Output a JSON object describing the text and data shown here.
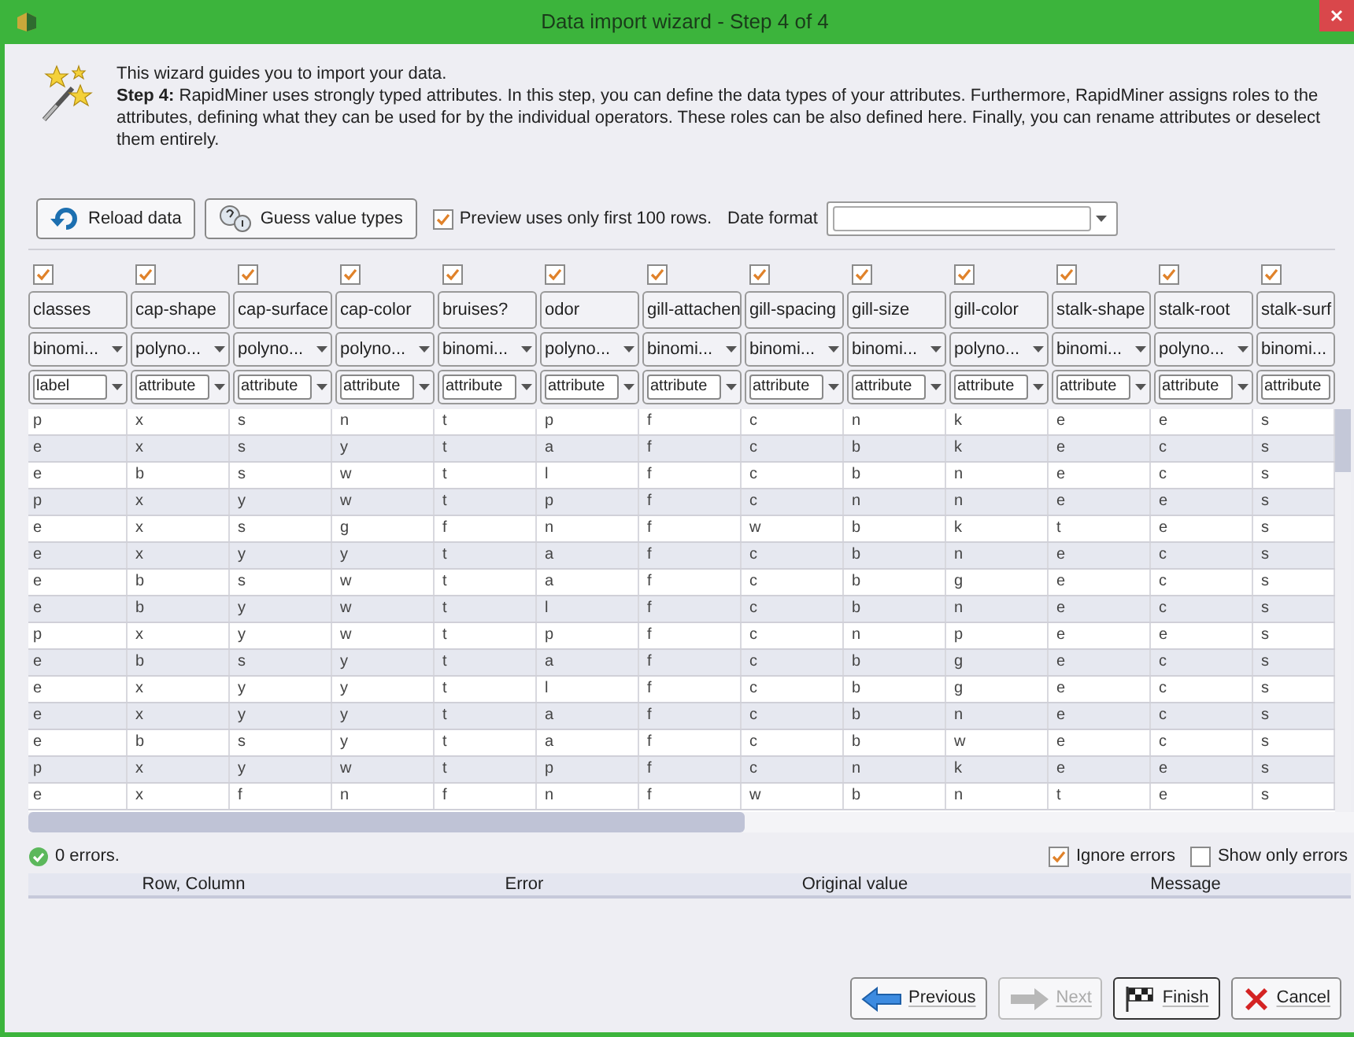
{
  "window": {
    "title": "Data import wizard - Step 4 of 4"
  },
  "intro": {
    "line": "This wizard guides you to import your data.",
    "text": "**Step 4:** RapidMiner uses strongly typed attributes. In this step, you can define the data types of your attributes. Furthermore, RapidMiner assigns roles to the attributes, defining what they can be used for by the individual operators. These roles can be also defined here. Finally, you can rename attributes or deselect them entirely."
  },
  "toolbar": {
    "reload": "Reload data",
    "guess": "Guess value types",
    "preview": {
      "label": "Preview uses only first 100 rows.",
      "checked": true
    },
    "date_format": {
      "label": "Date format"
    }
  },
  "columns": [
    {
      "name": "classes",
      "checked": true,
      "type": "binomi...",
      "role": "label"
    },
    {
      "name": "cap-shape",
      "checked": true,
      "type": "polyno...",
      "role": "attribute"
    },
    {
      "name": "cap-surface",
      "checked": true,
      "type": "polyno...",
      "role": "attribute"
    },
    {
      "name": "cap-color",
      "checked": true,
      "type": "polyno...",
      "role": "attribute"
    },
    {
      "name": "bruises?",
      "checked": true,
      "type": "binomi...",
      "role": "attribute"
    },
    {
      "name": "odor",
      "checked": true,
      "type": "polyno...",
      "role": "attribute"
    },
    {
      "name": "gill-attachen",
      "checked": true,
      "type": "binomi...",
      "role": "attribute"
    },
    {
      "name": "gill-spacing",
      "checked": true,
      "type": "binomi...",
      "role": "attribute"
    },
    {
      "name": "gill-size",
      "checked": true,
      "type": "binomi...",
      "role": "attribute"
    },
    {
      "name": "gill-color",
      "checked": true,
      "type": "polyno...",
      "role": "attribute"
    },
    {
      "name": "stalk-shape",
      "checked": true,
      "type": "binomi...",
      "role": "attribute"
    },
    {
      "name": "stalk-root",
      "checked": true,
      "type": "polyno...",
      "role": "attribute"
    },
    {
      "name": "stalk-surf",
      "checked": true,
      "type": "binomi...",
      "role": "attribute"
    }
  ],
  "rows": [
    [
      "p",
      "x",
      "s",
      "n",
      "t",
      "p",
      "f",
      "c",
      "n",
      "k",
      "e",
      "e",
      "s"
    ],
    [
      "e",
      "x",
      "s",
      "y",
      "t",
      "a",
      "f",
      "c",
      "b",
      "k",
      "e",
      "c",
      "s"
    ],
    [
      "e",
      "b",
      "s",
      "w",
      "t",
      "l",
      "f",
      "c",
      "b",
      "n",
      "e",
      "c",
      "s"
    ],
    [
      "p",
      "x",
      "y",
      "w",
      "t",
      "p",
      "f",
      "c",
      "n",
      "n",
      "e",
      "e",
      "s"
    ],
    [
      "e",
      "x",
      "s",
      "g",
      "f",
      "n",
      "f",
      "w",
      "b",
      "k",
      "t",
      "e",
      "s"
    ],
    [
      "e",
      "x",
      "y",
      "y",
      "t",
      "a",
      "f",
      "c",
      "b",
      "n",
      "e",
      "c",
      "s"
    ],
    [
      "e",
      "b",
      "s",
      "w",
      "t",
      "a",
      "f",
      "c",
      "b",
      "g",
      "e",
      "c",
      "s"
    ],
    [
      "e",
      "b",
      "y",
      "w",
      "t",
      "l",
      "f",
      "c",
      "b",
      "n",
      "e",
      "c",
      "s"
    ],
    [
      "p",
      "x",
      "y",
      "w",
      "t",
      "p",
      "f",
      "c",
      "n",
      "p",
      "e",
      "e",
      "s"
    ],
    [
      "e",
      "b",
      "s",
      "y",
      "t",
      "a",
      "f",
      "c",
      "b",
      "g",
      "e",
      "c",
      "s"
    ],
    [
      "e",
      "x",
      "y",
      "y",
      "t",
      "l",
      "f",
      "c",
      "b",
      "g",
      "e",
      "c",
      "s"
    ],
    [
      "e",
      "x",
      "y",
      "y",
      "t",
      "a",
      "f",
      "c",
      "b",
      "n",
      "e",
      "c",
      "s"
    ],
    [
      "e",
      "b",
      "s",
      "y",
      "t",
      "a",
      "f",
      "c",
      "b",
      "w",
      "e",
      "c",
      "s"
    ],
    [
      "p",
      "x",
      "y",
      "w",
      "t",
      "p",
      "f",
      "c",
      "n",
      "k",
      "e",
      "e",
      "s"
    ],
    [
      "e",
      "x",
      "f",
      "n",
      "f",
      "n",
      "f",
      "w",
      "b",
      "n",
      "t",
      "e",
      "s"
    ]
  ],
  "status": {
    "errors": "0 errors.",
    "ignore_errors": {
      "label": "Ignore errors",
      "checked": true
    },
    "show_only_errors": {
      "label": "Show only errors",
      "checked": false
    }
  },
  "error_table": {
    "columns": [
      "Row, Column",
      "Error",
      "Original value",
      "Message"
    ]
  },
  "buttons": [
    {
      "kind": "previous",
      "label": "Previous",
      "disabled": false
    },
    {
      "kind": "next",
      "label": "Next",
      "disabled": true
    },
    {
      "kind": "finish",
      "label": "Finish",
      "disabled": false
    },
    {
      "kind": "cancel",
      "label": "Cancel",
      "disabled": false
    }
  ]
}
